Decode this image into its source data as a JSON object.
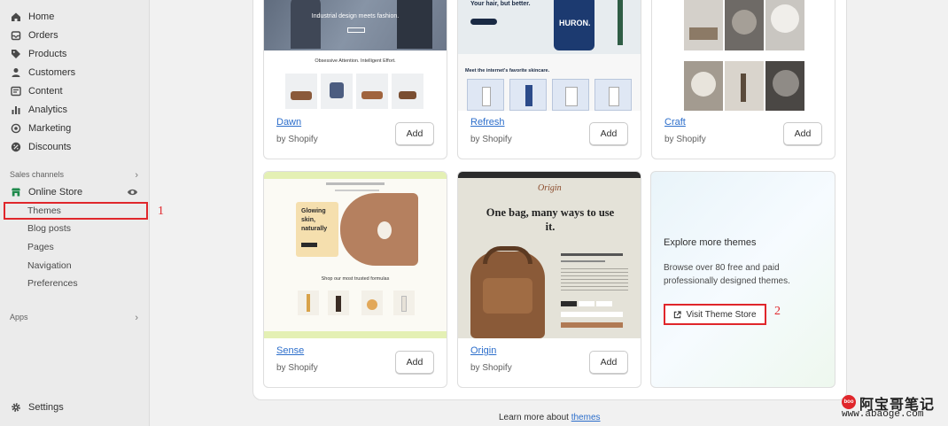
{
  "sidebar": {
    "items": [
      {
        "label": "Home",
        "icon": "home-icon"
      },
      {
        "label": "Orders",
        "icon": "orders-icon"
      },
      {
        "label": "Products",
        "icon": "tag-icon"
      },
      {
        "label": "Customers",
        "icon": "person-icon"
      },
      {
        "label": "Content",
        "icon": "content-icon"
      },
      {
        "label": "Analytics",
        "icon": "bar-chart-icon"
      },
      {
        "label": "Marketing",
        "icon": "target-icon"
      },
      {
        "label": "Discounts",
        "icon": "discount-icon"
      }
    ],
    "sales_channels_label": "Sales channels",
    "online_store": {
      "label": "Online Store",
      "icon": "store-icon"
    },
    "sub_items": [
      "Themes",
      "Blog posts",
      "Pages",
      "Navigation",
      "Preferences"
    ],
    "apps_label": "Apps",
    "settings_label": "Settings"
  },
  "annotations": {
    "one": "1",
    "two": "2"
  },
  "themes": [
    {
      "name": "Dawn",
      "by": "by Shopify",
      "add": "Add",
      "headline": "Industrial design meets fashion.",
      "subline": "Obsessive Attention. Intelligent Effort."
    },
    {
      "name": "Refresh",
      "by": "by Shopify",
      "add": "Add",
      "headline": "Your hair, but better.",
      "brand": "HURON.",
      "subline": "Meet the internet's favorite skincare."
    },
    {
      "name": "Craft",
      "by": "by Shopify",
      "add": "Add"
    },
    {
      "name": "Sense",
      "by": "by Shopify",
      "add": "Add",
      "headline": "Glowing skin, naturally",
      "subline": "Shop our most trusted formulas"
    },
    {
      "name": "Origin",
      "by": "by Shopify",
      "add": "Add",
      "brand": "Origin",
      "headline": "One bag, many ways to use it."
    }
  ],
  "explore": {
    "title": "Explore more themes",
    "description": "Browse over 80 free and paid professionally designed themes.",
    "button": "Visit Theme Store"
  },
  "footer": {
    "prefix": "Learn more about ",
    "link": "themes"
  },
  "watermark": {
    "logo": "boo",
    "cn": "阿宝哥笔记",
    "url": "www.abaoge.com"
  },
  "colors": {
    "accent_red": "#e0262b",
    "link_blue": "#2c6ecb"
  }
}
